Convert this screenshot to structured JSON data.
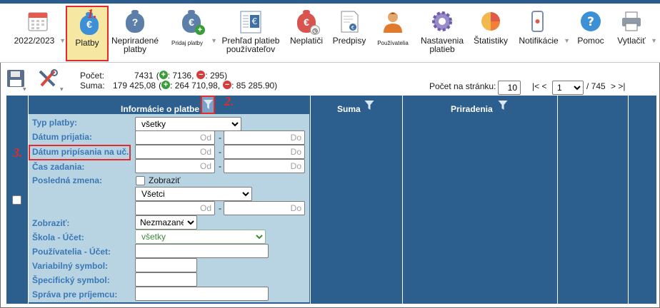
{
  "toolbar": {
    "year": "2022/2023",
    "items": [
      {
        "label": "Platby"
      },
      {
        "label": "Nepriradené platby"
      },
      {
        "label": "Pridaj platby"
      },
      {
        "label": "Prehľad platieb používateľov"
      },
      {
        "label": "Neplatiči"
      },
      {
        "label": "Predpisy"
      },
      {
        "label": "Používatelia"
      },
      {
        "label": "Nastavenia platieb"
      },
      {
        "label": "Štatistiky"
      },
      {
        "label": "Notifikácie"
      },
      {
        "label": "Pomoc"
      },
      {
        "label": "Vytlačiť"
      }
    ],
    "colors": {
      "active_bg": "#f6e7a2",
      "highlight": "#e42a2a",
      "bag_blue": "#3d8fd6",
      "bag_red": "#d9534f"
    }
  },
  "annotations": {
    "one": "1.",
    "two": "2.",
    "three": "3."
  },
  "stats": {
    "count_label": "Počet:",
    "count_value": "7431",
    "count_plus": ": 7136,",
    "count_minus": ": 295)",
    "sum_label": "Suma:",
    "sum_value": "179 425,08",
    "sum_plus": ": 264 710,98,",
    "sum_minus": ": 85 285.90)",
    "open_paren": "("
  },
  "pager": {
    "per_page_label": "Počet na stránku:",
    "per_page_value": "10",
    "first_prev": "|< <",
    "page_value": "1",
    "page_total": "/ 745",
    "next_last": "> >|"
  },
  "grid": {
    "col_info": "Informácie o platbe",
    "col_sum": "Suma",
    "col_assign": "Priradenia",
    "header_bg": "#2c5e8e",
    "panel_bg": "#b8d3e2"
  },
  "filters": {
    "typ_platby": "Typ platby:",
    "typ_platby_value": "všetky",
    "datum_prijatia": "Dátum prijatia:",
    "datum_pripisania": "Dátum pripísania na uč.:",
    "cas_zadania": "Čas zadania:",
    "posledna_zmena": "Posledná zmena:",
    "zobrazit_check": "Zobraziť",
    "vsetci": "Všetci",
    "zobrazit": "Zobraziť:",
    "zobrazit_value": "Nezmazané",
    "skola_ucet": "Škola - Účet:",
    "skola_ucet_value": "všetky",
    "pouzivatelia_ucet": "Používatelia - Účet:",
    "variabilny": "Variabilný symbol:",
    "specificky": "Špecifický symbol:",
    "sprava": "Správa pre príjemcu:",
    "od": "Od",
    "do": "Do",
    "dash": "-"
  }
}
